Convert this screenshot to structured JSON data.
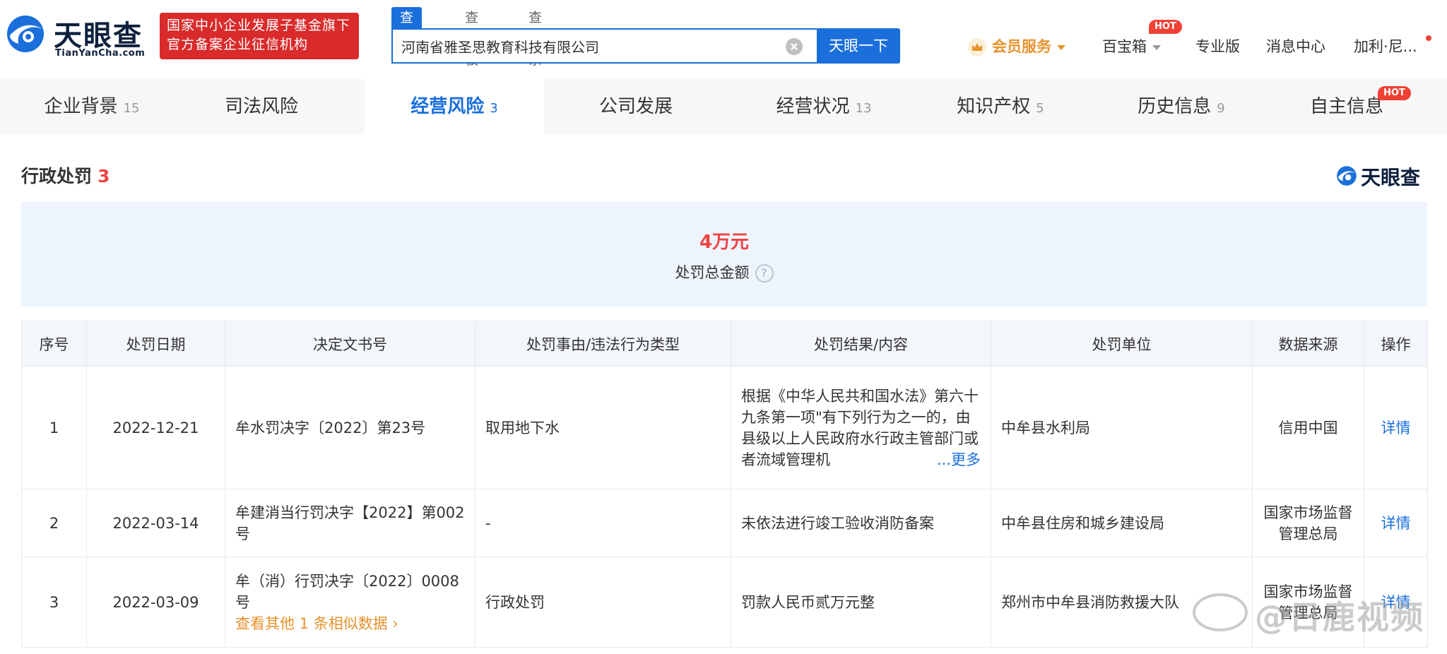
{
  "header": {
    "logo_cn": "天眼查",
    "logo_en": "TianYanCha.com",
    "gov_badge": [
      "国家中小企业发展子基金旗下",
      "官方备案企业征信机构"
    ],
    "search_tabs": [
      "查公司",
      "查老板",
      "查关系"
    ],
    "search_value": "河南省雅圣思教育科技有限公司",
    "search_button": "天眼一下",
    "member_service": "会员服务",
    "treasure_box": "百宝箱",
    "hot_label": "HOT",
    "pro_version": "专业版",
    "message_center": "消息中心",
    "user_name": "加利·尼..."
  },
  "category_tabs": [
    {
      "label": "企业背景",
      "count": "15"
    },
    {
      "label": "司法风险",
      "count": ""
    },
    {
      "label": "经营风险",
      "count": "3"
    },
    {
      "label": "公司发展",
      "count": ""
    },
    {
      "label": "经营状况",
      "count": "13"
    },
    {
      "label": "知识产权",
      "count": "5"
    },
    {
      "label": "历史信息",
      "count": "9"
    },
    {
      "label": "自主信息",
      "count": ""
    }
  ],
  "section": {
    "title": "行政处罚",
    "count": "3",
    "brand": "天眼查",
    "total_amount": "4万元",
    "total_label": "处罚总金额",
    "help_icon": "?"
  },
  "table": {
    "headers": [
      "序号",
      "处罚日期",
      "决定文书号",
      "处罚事由/违法行为类型",
      "处罚结果/内容",
      "处罚单位",
      "数据来源",
      "操作"
    ],
    "rows": [
      {
        "no": "1",
        "date": "2022-12-21",
        "doc": "牟水罚决字〔2022〕第23号",
        "reason": "取用地下水",
        "result": "根据《中华人民共和国水法》第六十九条第一项\"有下列行为之一的，由县级以上人民政府水行政主管部门或者流域管理机",
        "more": "...更多",
        "unit": "中牟县水利局",
        "source": "信用中国",
        "action": "详情"
      },
      {
        "no": "2",
        "date": "2022-03-14",
        "doc": "牟建消当行罚决字【2022】第002号",
        "reason": "-",
        "result": "未依法进行竣工验收消防备案",
        "unit": "中牟县住房和城乡建设局",
        "source": "国家市场监督管理总局",
        "action": "详情"
      },
      {
        "no": "3",
        "date": "2022-03-09",
        "doc": "牟（消）行罚决字〔2022〕0008号",
        "similar": "查看其他 1 条相似数据 ›",
        "reason": "行政处罚",
        "result": "罚款人民币贰万元整",
        "unit": "郑州市中牟县消防救援大队",
        "source": "国家市场监督管理总局",
        "action": "详情"
      }
    ]
  },
  "watermark": "@日鹿视频",
  "colors": {
    "accent": "#1a6fdb",
    "danger": "#e44444",
    "gold": "#e8922c",
    "badge_red": "#d92b2b"
  }
}
